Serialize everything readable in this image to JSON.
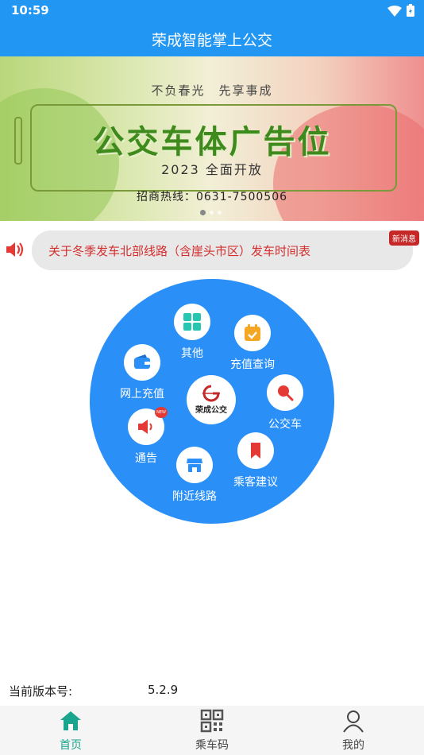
{
  "status_bar": {
    "time": "10:59"
  },
  "app": {
    "title": "荣成智能掌上公交"
  },
  "banner": {
    "slogan": "不负春光　先享事成",
    "headline": "公交车体广告位",
    "subline": "2023 全面开放",
    "hotline": "招商热线：0631-7500506"
  },
  "notice": {
    "text": "关于冬季发车北部线路（含崖头市区）发车时间表",
    "badge": "新消息"
  },
  "menu": {
    "center_logo": "荣成公交",
    "items": [
      {
        "label": "其他",
        "icon": "grid-icon"
      },
      {
        "label": "充值查询",
        "icon": "calendar-check-icon"
      },
      {
        "label": "网上充值",
        "icon": "wallet-icon"
      },
      {
        "label": "公交车",
        "icon": "search-icon"
      },
      {
        "label": "通告",
        "icon": "megaphone-icon",
        "badge": "NEW"
      },
      {
        "label": "附近线路",
        "icon": "store-icon"
      },
      {
        "label": "乘客建议",
        "icon": "bookmark-icon"
      }
    ]
  },
  "version": {
    "label": "当前版本号:",
    "value": "5.2.9"
  },
  "bottom_nav": {
    "items": [
      {
        "label": "首页",
        "icon": "home-icon",
        "active": true
      },
      {
        "label": "乘车码",
        "icon": "qr-code-icon",
        "active": false
      },
      {
        "label": "我的",
        "icon": "user-icon",
        "active": false
      }
    ]
  },
  "colors": {
    "primary": "#2196f3",
    "circle": "#2a8ff7",
    "notice_text": "#d32f2f",
    "active_nav": "#1aa58f",
    "banner_headline": "#3f8a1c"
  }
}
